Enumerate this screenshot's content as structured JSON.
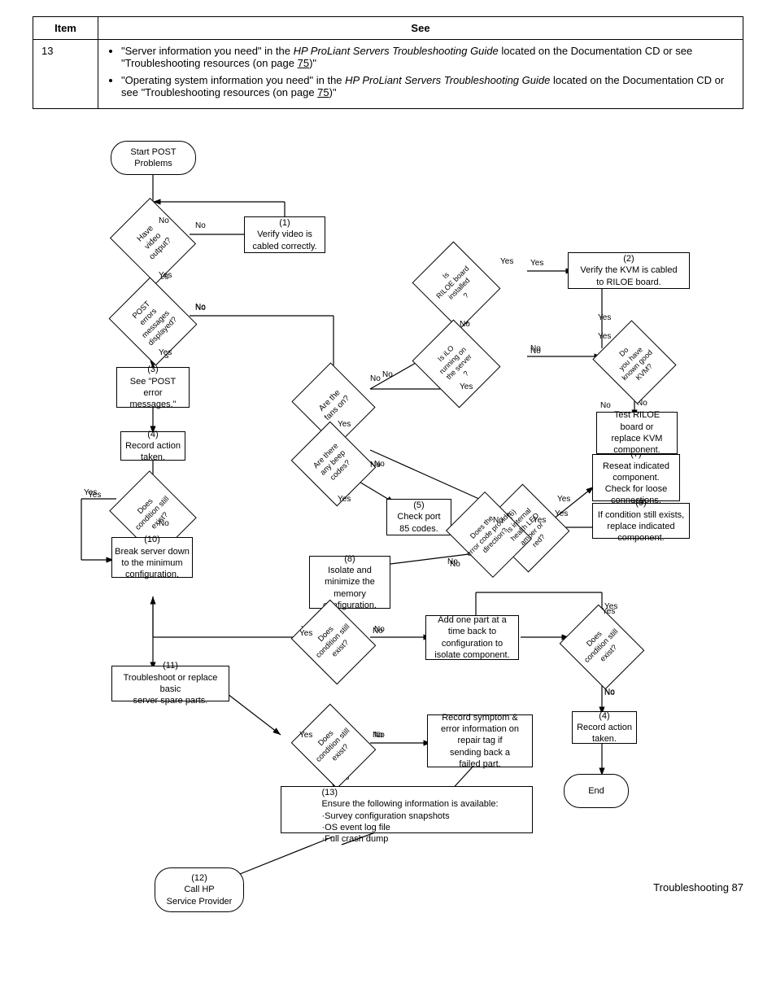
{
  "table": {
    "col1_header": "Item",
    "col2_header": "See",
    "row_item": "13",
    "bullets": [
      "\"Server information you need\" in the HP ProLiant Servers Troubleshooting Guide located on the Documentation CD or see \"Troubleshooting resources (on page 75)\"",
      "\"Operating system information you need\" in the HP ProLiant Servers Troubleshooting Guide located on the Documentation CD or see \"Troubleshooting resources (on page 75)\""
    ]
  },
  "flowchart": {
    "nodes": {
      "start": "Start POST\nProblems",
      "have_video": "Have\nvideo\noutput?",
      "verify_video": "(1)\nVerify video is\ncabled correctly.",
      "post_errors": "POST\nerrors\nmessages\ndisplayed?",
      "see_post": "(3)\nSee \"POST\nerror\nmessages.\"",
      "record_action_4a": "(4)\nRecord action\ntaken.",
      "does_condition_4a": "Does\ncondition still\nexist?",
      "break_server": "(10)\nBreak server down\nto the minimum\nconfiguration.",
      "fans_on": "Are the\nfans on?",
      "beep_codes": "Are there\nany beep\ncodes?",
      "check_port": "(5)\nCheck port\n85 codes.",
      "error_code_dir": "Does the\nerror code provide\ndirection?",
      "isolate_memory": "(8)\nIsolate and\nminimize the\nmemory\nconfiguration.",
      "internal_health": "(6)\nIs internal\nhealth LED\namber or\nred?",
      "reseat": "(7)\nReseat indicated\ncomponent.\nCheck for loose\nconnections.",
      "replace_comp": "(9)\nIf condition still exists,\nreplace indicated\ncomponent.",
      "does_condition_b": "Does\ncondition still\nexist?",
      "add_one_part": "Add one part at a\ntime back to\nconfiguration to\nisolate component.",
      "does_condition_c": "Does\ncondition still\nexist?",
      "does_condition_c2": "Does\ncondition still\nexist?",
      "record_symptom": "Record symptom &\nerror information on\nrepair tag if\nsending back a\nfailed part.",
      "does_condition_d": "Does\ncondition still\nexist?",
      "record_action_4b": "(4)\nRecord action\ntaken.",
      "troubleshoot": "(11)\nTroubleshoot or replace basic\nserver spare parts.",
      "ensure_info": "(13)\nEnsure the following information is available:\n·Survey configuration snapshots\n·OS event log file\n·Full crash dump",
      "call_hp": "(12)\nCall HP\nService Provider",
      "end": "End",
      "is_riloe": "Is\nRILOE board\ninstalled\n?",
      "verify_kvm": "(2)\nVerify the KVM is cabled\nto RILOE board.",
      "is_ilo": "Is iLO\nrunning on\nthe server\n?",
      "do_you_have_kvm": "Do\nyou have\nknown good\nKVM?",
      "test_riloe": "Test RILOE\nboard or\nreplace KVM\ncomponent."
    },
    "labels": {
      "yes": "Yes",
      "no": "No"
    }
  },
  "footer": {
    "text": "Troubleshooting   87"
  }
}
